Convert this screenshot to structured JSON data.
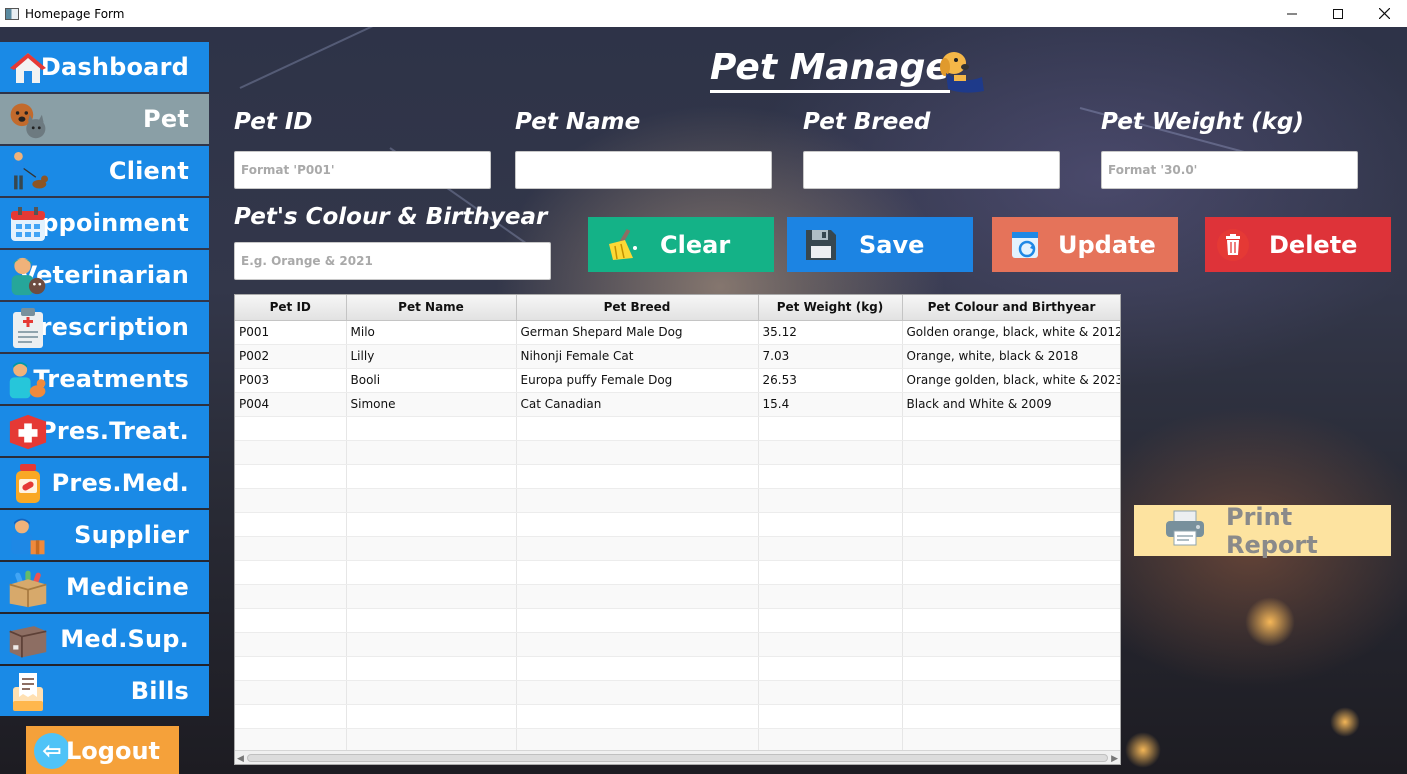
{
  "window": {
    "title": "Homepage Form",
    "minimize_icon": "minimize-icon",
    "maximize_icon": "maximize-icon",
    "close_icon": "close-icon"
  },
  "sidebar": {
    "items": [
      {
        "label": "Dashboard",
        "icon": "house-icon"
      },
      {
        "label": "Pet",
        "icon": "pets-icon",
        "active": true
      },
      {
        "label": "Client",
        "icon": "person-with-dog-icon"
      },
      {
        "label": "Appoinment",
        "icon": "calendar-icon"
      },
      {
        "label": "Veterinarian",
        "icon": "vet-icon"
      },
      {
        "label": "Prescription",
        "icon": "clipboard-icon"
      },
      {
        "label": "Treatments",
        "icon": "vet-treatment-icon"
      },
      {
        "label": "Pres.Treat.",
        "icon": "medical-cross-icon"
      },
      {
        "label": "Pres.Med.",
        "icon": "medicine-bottle-icon"
      },
      {
        "label": "Supplier",
        "icon": "delivery-person-icon"
      },
      {
        "label": "Medicine",
        "icon": "medicine-box-icon"
      },
      {
        "label": "Med.Sup.",
        "icon": "cardboard-box-icon"
      },
      {
        "label": "Bills",
        "icon": "receipt-icon"
      }
    ],
    "logout_label": "Logout"
  },
  "page": {
    "title": "Pet Manage",
    "title_icon": "dog-icon"
  },
  "form": {
    "pet_id": {
      "label": "Pet ID",
      "placeholder": "Format 'P001'"
    },
    "pet_name": {
      "label": "Pet Name",
      "placeholder": ""
    },
    "pet_breed": {
      "label": "Pet Breed",
      "placeholder": ""
    },
    "pet_weight": {
      "label": "Pet Weight (kg)",
      "placeholder": "Format '30.0'"
    },
    "pet_colour": {
      "label": "Pet's Colour & Birthyear",
      "placeholder": "E.g. Orange & 2021"
    }
  },
  "buttons": {
    "clear": {
      "label": "Clear",
      "color": "#14b287",
      "icon": "broom-icon"
    },
    "save": {
      "label": "Save",
      "color": "#1c84e3",
      "icon": "floppy-disk-icon"
    },
    "update": {
      "label": "Update",
      "color": "#e5735a",
      "icon": "update-icon"
    },
    "delete": {
      "label": "Delete",
      "color": "#de3339",
      "icon": "trash-icon"
    },
    "print": {
      "label": "Print Report",
      "color": "#fde3a0",
      "icon": "printer-icon"
    }
  },
  "table": {
    "columns": [
      "Pet ID",
      "Pet Name",
      "Pet Breed",
      "Pet Weight (kg)",
      "Pet Colour and Birthyear"
    ],
    "rows": [
      [
        "P001",
        "Milo",
        "German Shepard Male Dog",
        "35.12",
        "Golden orange, black, white & 2012"
      ],
      [
        "P002",
        "Lilly",
        "Nihonji Female Cat",
        "7.03",
        "Orange, white, black & 2018"
      ],
      [
        "P003",
        "Booli",
        "Europa puffy Female Dog",
        "26.53",
        "Orange golden, black, white & 2023"
      ],
      [
        "P004",
        "Simone",
        "Cat Canadian",
        "15.4",
        "Black and White & 2009"
      ]
    ],
    "empty_rows": 14
  }
}
